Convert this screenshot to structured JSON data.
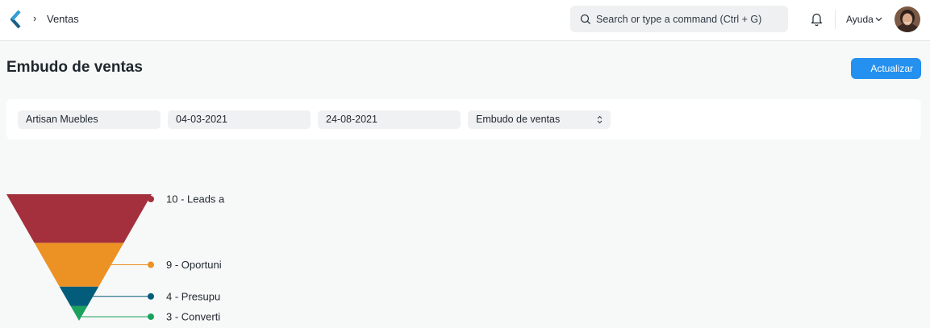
{
  "navbar": {
    "breadcrumb_label": "Ventas",
    "search_placeholder": "Search or type a command (Ctrl + G)",
    "help_label": "Ayuda"
  },
  "page": {
    "title": "Embudo de ventas",
    "primary_button_label": "Actualizar"
  },
  "filters": {
    "company": "Artisan Muebles",
    "from_date": "04-03-2021",
    "to_date": "24-08-2021",
    "chart_type": "Embudo de ventas"
  },
  "colors": {
    "primary": "#2490ef",
    "stage_1": "#a3303c",
    "stage_2": "#ec9124",
    "stage_3": "#035d7a",
    "stage_4": "#1aa25d"
  },
  "chart_data": {
    "type": "funnel",
    "stages": [
      {
        "label": "10 - Leads a",
        "value": 10,
        "color": "#a3303c"
      },
      {
        "label": "9 - Oportuni",
        "value": 9,
        "color": "#ec9124"
      },
      {
        "label": "4 - Presupu",
        "value": 4,
        "color": "#035d7a"
      },
      {
        "label": "3 - Converti",
        "value": 3,
        "color": "#1aa25d"
      }
    ]
  }
}
